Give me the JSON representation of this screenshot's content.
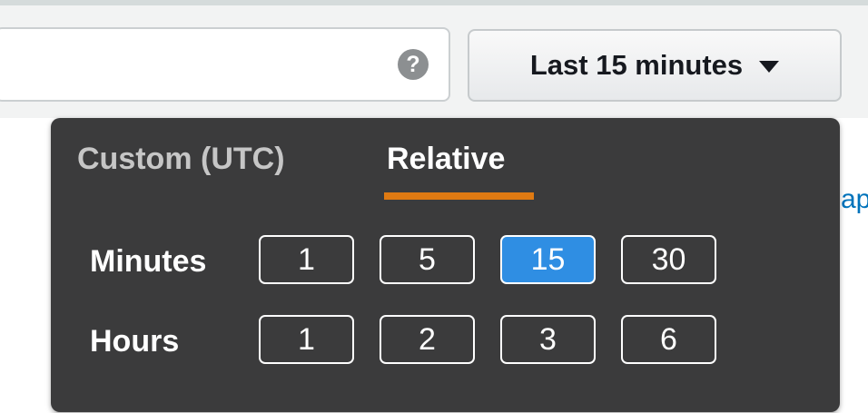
{
  "search": {
    "help_icon": "?"
  },
  "time_range": {
    "label": "Last 15 minutes",
    "caret_icon": "caret-down-icon"
  },
  "background_text": "ap",
  "dropdown": {
    "tabs": [
      {
        "label": "Custom (UTC)",
        "active": false
      },
      {
        "label": "Relative",
        "active": true
      }
    ],
    "accent_color": "#df7a12",
    "selected_color": "#2f8ee3",
    "rows": [
      {
        "label": "Minutes",
        "options": [
          "1",
          "5",
          "15",
          "30"
        ],
        "selected": "15"
      },
      {
        "label": "Hours",
        "options": [
          "1",
          "2",
          "3",
          "6"
        ],
        "selected": null
      }
    ]
  }
}
